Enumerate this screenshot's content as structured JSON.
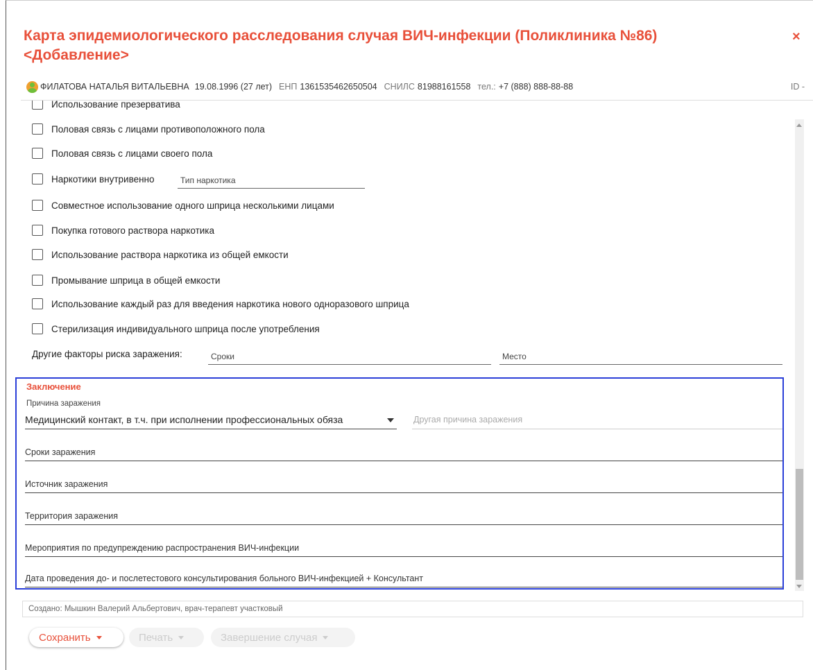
{
  "dialog": {
    "title": "Карта эпидемиологического расследования случая ВИЧ-инфекции (Поликлиника №86) <Добавление>",
    "close_glyph": "×"
  },
  "patient": {
    "icon": "person-icon",
    "name": "ФИЛАТОВА НАТАЛЬЯ ВИТАЛЬЕВНА",
    "birth": "19.08.1996 (27 лет)",
    "enp_label": "ЕНП",
    "enp": "1361535462650504",
    "snils_label": "СНИЛС",
    "snils": "81988161558",
    "phone_label": "тел.:",
    "phone": "+7 (888) 888-88-88",
    "id_label": "ID -"
  },
  "risk_factors": [
    "Использование презерватива",
    "Половая связь с лицами противоположного пола",
    "Половая связь с лицами своего пола",
    "Наркотики внутривенно",
    "Совместное использование одного шприца несколькими лицами",
    "Покупка готового раствора наркотика",
    "Использование раствора наркотика из общей емкости",
    "Промывание шприца в общей емкости",
    "Использование каждый раз для введения наркотика нового одноразового шприца",
    "Стерилизация индивидуального шприца после употребления"
  ],
  "drug_type_placeholder": "Тип наркотика",
  "other_factors": {
    "label": "Другие факторы риска заражения:",
    "terms_placeholder": "Сроки",
    "place_placeholder": "Место"
  },
  "conclusion": {
    "title": "Заключение",
    "cause_label": "Причина заражения",
    "cause_value": "Медицинский контакт, в т.ч. при исполнении профессиональных обяза",
    "other_cause_placeholder": "Другая причина заражения",
    "fields": [
      "Сроки заражения",
      "Источник заражения",
      "Территория заражения",
      "Мероприятия по предупреждению распространения ВИЧ-инфекции",
      "Дата проведения до- и послетестового консультирования больного ВИЧ-инфекцией + Консультант"
    ]
  },
  "created": "Создано:  Мышкин Валерий Альбертович, врач-терапевт участковый",
  "buttons": {
    "save": "Сохранить",
    "print": "Печать",
    "finish": "Завершение случая"
  },
  "colors": {
    "accent": "#e8503a",
    "highlight_border": "#2a3ed8"
  }
}
